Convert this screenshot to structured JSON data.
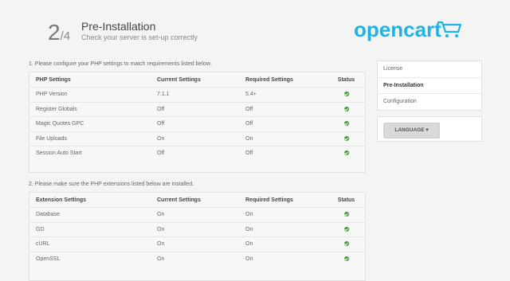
{
  "header": {
    "step_number": "2",
    "step_total": "/4",
    "title": "Pre-Installation",
    "subtitle": "Check your server is set-up correctly",
    "logo_text": "opencart"
  },
  "sections": [
    {
      "note": "1. Please configure your PHP settings to match requirements listed below.",
      "columns": [
        "PHP Settings",
        "Current Settings",
        "Required Settings",
        "Status"
      ],
      "rows": [
        {
          "name": "PHP Version",
          "current": "7.1.1",
          "required": "5.4+",
          "status": "ok"
        },
        {
          "name": "Register Globals",
          "current": "Off",
          "required": "Off",
          "status": "ok"
        },
        {
          "name": "Magic Quotes GPC",
          "current": "Off",
          "required": "Off",
          "status": "ok"
        },
        {
          "name": "File Uploads",
          "current": "On",
          "required": "On",
          "status": "ok"
        },
        {
          "name": "Session Auto Start",
          "current": "Off",
          "required": "Off",
          "status": "ok"
        }
      ]
    },
    {
      "note": "2. Please make sure the PHP extensions listed below are installed.",
      "columns": [
        "Extension Settings",
        "Current Settings",
        "Required Settings",
        "Status"
      ],
      "rows": [
        {
          "name": "Database",
          "current": "On",
          "required": "On",
          "status": "ok"
        },
        {
          "name": "GD",
          "current": "On",
          "required": "On",
          "status": "ok"
        },
        {
          "name": "cURL",
          "current": "On",
          "required": "On",
          "status": "ok"
        },
        {
          "name": "OpenSSL",
          "current": "On",
          "required": "On",
          "status": "ok"
        }
      ]
    }
  ],
  "sidebar": {
    "items": [
      {
        "label": "License",
        "active": false
      },
      {
        "label": "Pre-Installation",
        "active": true
      },
      {
        "label": "Configuration",
        "active": false
      }
    ]
  },
  "language": {
    "button_label": "LANGUAGE ▾"
  },
  "colors": {
    "brand": "#1fb3e3",
    "status_ok": "#3f9a2f"
  },
  "icons": {
    "status": "check-circle-icon",
    "logo": "cart-icon"
  }
}
